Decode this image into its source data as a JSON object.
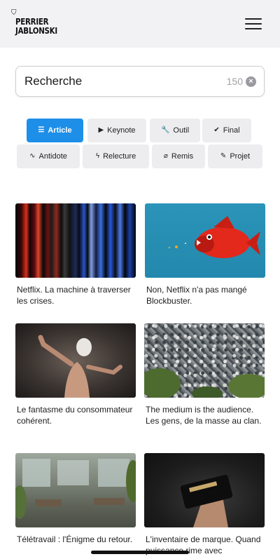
{
  "brand": {
    "line1": "PERRIER",
    "line2": "JABLONSKI"
  },
  "search": {
    "value": "Recherche",
    "count": "150"
  },
  "filters": [
    {
      "label": "Article",
      "icon": "list-icon",
      "active": true
    },
    {
      "label": "Keynote",
      "icon": "play-icon",
      "active": false
    },
    {
      "label": "Outil",
      "icon": "wrench-icon",
      "active": false
    },
    {
      "label": "Final",
      "icon": "check-circle-icon",
      "active": false
    },
    {
      "label": "Antidote",
      "icon": "wave-icon",
      "active": false
    },
    {
      "label": "Relecture",
      "icon": "bolt-icon",
      "active": false
    },
    {
      "label": "Remis",
      "icon": "paperclip-icon",
      "active": false
    },
    {
      "label": "Projet",
      "icon": "pen-icon",
      "active": false
    }
  ],
  "articles": [
    {
      "title": "Netflix. La machine à traverser les crises."
    },
    {
      "title": "Non, Netflix n'a pas mangé Blockbuster."
    },
    {
      "title": "Le fantasme du consommateur cohérent."
    },
    {
      "title": "The medium is the audience. Les gens, de la masse au clan."
    },
    {
      "title": "Télétravail : l'Énigme du retour."
    },
    {
      "title": "L'inventaire de marque. Quand puissance rime avec"
    }
  ],
  "colors": {
    "accent": "#1e8fe8",
    "chip": "#ededf0",
    "header": "#f2f2f4"
  }
}
